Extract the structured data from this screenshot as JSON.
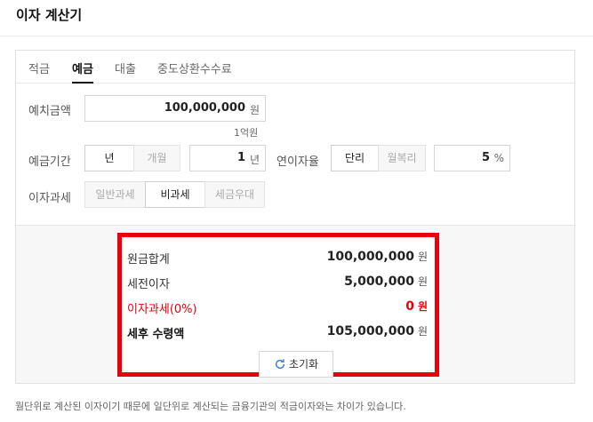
{
  "app": {
    "title": "이자 계산기"
  },
  "tabs": [
    {
      "label": "적금",
      "active": false
    },
    {
      "label": "예금",
      "active": true
    },
    {
      "label": "대출",
      "active": false
    },
    {
      "label": "중도상환수수료",
      "active": false
    }
  ],
  "deposit": {
    "label": "예치금액",
    "value": "100,000,000",
    "unit": "원",
    "hint": "1억원"
  },
  "period": {
    "label": "예금기간",
    "options": [
      "년",
      "개월"
    ],
    "selected": "년",
    "value": "1",
    "unit": "년"
  },
  "rate": {
    "label": "연이자율",
    "options": [
      "단리",
      "월복리"
    ],
    "selected": "단리",
    "value": "5",
    "unit": "%"
  },
  "tax": {
    "label": "이자과세",
    "options": [
      "일반과세",
      "비과세",
      "세금우대"
    ],
    "selected": "비과세"
  },
  "results": {
    "principal": {
      "label": "원금합계",
      "value": "100,000,000",
      "unit": "원"
    },
    "pretax_interest": {
      "label": "세전이자",
      "value": "5,000,000",
      "unit": "원"
    },
    "interest_tax": {
      "label": "이자과세(0%)",
      "value": "0",
      "unit": "원"
    },
    "net_total": {
      "label": "세후 수령액",
      "value": "105,000,000",
      "unit": "원"
    }
  },
  "reset_label": "초기화",
  "footnote": "월단위로 계산된 이자이기 때문에 일단위로 계산되는 금융기관의 적금이자와는 차이가 있습니다.",
  "colors": {
    "highlight_border": "#e8000b",
    "negative_text": "#e8000b"
  },
  "icons": {
    "reset": "refresh-icon"
  }
}
